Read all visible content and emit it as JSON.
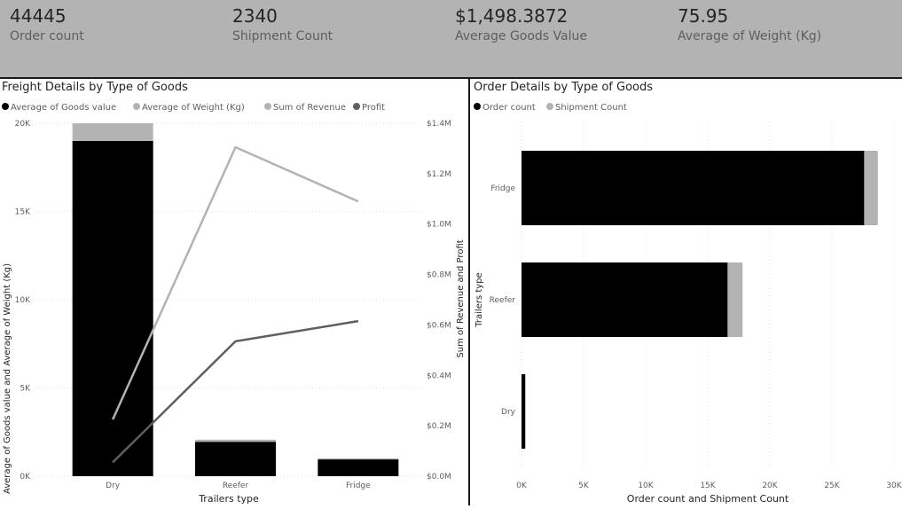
{
  "kpis": [
    {
      "value": "44445",
      "label": "Order count"
    },
    {
      "value": "2340",
      "label": "Shipment Count"
    },
    {
      "value": "$1,498.3872",
      "label": "Average Goods Value"
    },
    {
      "value": "75.95",
      "label": "Average of Weight (Kg)"
    }
  ],
  "colors": {
    "goods_value": "#000000",
    "weight": "#b3b3b3",
    "revenue": "#b3b3b3",
    "profit": "#5f5f5f",
    "order_count": "#000000",
    "shipment_count": "#b3b3b3",
    "kpi_band": "#b3b3b3"
  },
  "chart_data": [
    {
      "type": "bar",
      "title": "Freight Details by Type of Goods",
      "legend_position": "top-left",
      "legend": [
        "Average of Goods value",
        "Average of Weight (Kg)",
        "Sum of Revenue",
        "Profit"
      ],
      "categories": [
        "Dry",
        "Reefer",
        "Fridge"
      ],
      "xlabel": "Trailers type",
      "ylabel": "Average of Goods value and Average of Weight (Kg)",
      "y2label": "Sum of Revenue and Profit",
      "ylim": [
        0,
        20000
      ],
      "y2lim": [
        0,
        1400000
      ],
      "yticks": [
        {
          "value": 0,
          "label": "0K"
        },
        {
          "value": 5000,
          "label": "5K"
        },
        {
          "value": 10000,
          "label": "10K"
        },
        {
          "value": 15000,
          "label": "15K"
        },
        {
          "value": 20000,
          "label": "20K"
        }
      ],
      "y2ticks": [
        {
          "value": 0,
          "label": "$0.0M"
        },
        {
          "value": 200000,
          "label": "$0.2M"
        },
        {
          "value": 400000,
          "label": "$0.4M"
        },
        {
          "value": 600000,
          "label": "$0.6M"
        },
        {
          "value": 800000,
          "label": "$0.8M"
        },
        {
          "value": 1000000,
          "label": "$1.0M"
        },
        {
          "value": 1200000,
          "label": "$1.2M"
        },
        {
          "value": 1400000,
          "label": "$1.4M"
        }
      ],
      "grid": true,
      "series": [
        {
          "name": "Average of Goods value",
          "kind": "bar",
          "axis": "left",
          "values": [
            19000,
            1950,
            950
          ]
        },
        {
          "name": "Average of Weight (Kg)",
          "kind": "bar",
          "axis": "left",
          "values": [
            1000,
            120,
            60
          ]
        },
        {
          "name": "Sum of Revenue",
          "kind": "line",
          "axis": "right",
          "values": [
            225000,
            1305000,
            1090000
          ]
        },
        {
          "name": "Profit",
          "kind": "line",
          "axis": "right",
          "values": [
            55000,
            535000,
            615000
          ]
        }
      ]
    },
    {
      "type": "bar",
      "orientation": "horizontal",
      "title": "Order Details by Type of Goods",
      "legend_position": "top-left",
      "legend": [
        "Order count",
        "Shipment Count"
      ],
      "categories": [
        "Fridge",
        "Reefer",
        "Dry"
      ],
      "xlabel": "Order count and Shipment Count",
      "ylabel": "Trailers type",
      "xlim": [
        0,
        30000
      ],
      "xticks": [
        {
          "value": 0,
          "label": "0K"
        },
        {
          "value": 5000,
          "label": "5K"
        },
        {
          "value": 10000,
          "label": "10K"
        },
        {
          "value": 15000,
          "label": "15K"
        },
        {
          "value": 20000,
          "label": "20K"
        },
        {
          "value": 25000,
          "label": "25K"
        },
        {
          "value": 30000,
          "label": "30K"
        }
      ],
      "grid": true,
      "series": [
        {
          "name": "Order count",
          "values": [
            27600,
            16600,
            300
          ]
        },
        {
          "name": "Shipment Count",
          "values": [
            1100,
            1200,
            40
          ]
        }
      ]
    }
  ]
}
